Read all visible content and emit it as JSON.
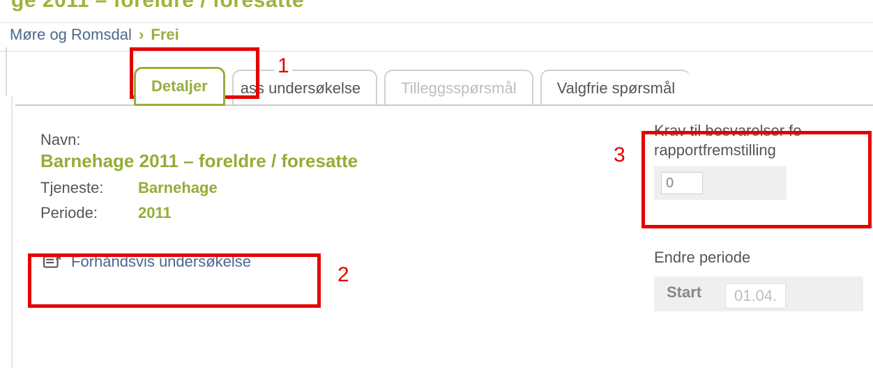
{
  "page_title_cut": "ge 2011 – foreldre / foresatte",
  "breadcrumb": {
    "parent": "Møre og Romsdal",
    "current": "Frei"
  },
  "tabs": {
    "detaljer": "Detaljer",
    "tilpass_partial": "ass undersøkelse",
    "tillegg": "Tilleggsspørsmål",
    "valgfrie": "Valgfrie spørsmål"
  },
  "details": {
    "navn_label": "Navn:",
    "navn_value": "Barnehage 2011 – foreldre / foresatte",
    "tjeneste_label": "Tjeneste:",
    "tjeneste_value": "Barnehage",
    "periode_label": "Periode:",
    "periode_value": "2011",
    "preview_link": "Forhåndsvis undersøkelse"
  },
  "right": {
    "krav_label_line1": "Krav til besvarelser fo",
    "krav_label_line2": "rapportfremstilling",
    "krav_value": "0",
    "endre_label": "Endre periode",
    "start_label": "Start",
    "start_date": "01.04."
  },
  "annotations": {
    "n1": "1",
    "n2": "2",
    "n3": "3"
  }
}
